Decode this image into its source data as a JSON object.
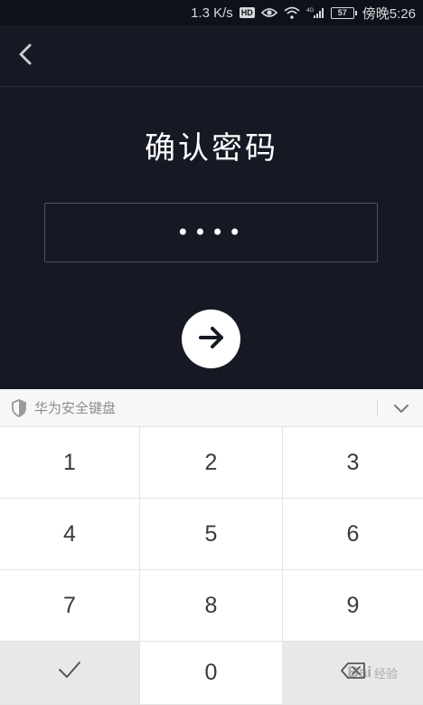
{
  "status_bar": {
    "network_speed": "1.3 K/s",
    "hd_badge": "HD",
    "battery": "57",
    "time": "傍晚5:26",
    "icons": [
      "eye-icon",
      "wifi-icon",
      "4g-signal-icon",
      "battery-icon"
    ]
  },
  "header": {
    "back_icon": "chevron-left-icon"
  },
  "page": {
    "title": "确认密码",
    "password_value": "••••",
    "next_icon": "arrow-right-icon"
  },
  "keyboard": {
    "name": "华为安全键盘",
    "shield_icon": "shield-icon",
    "collapse_icon": "chevron-down-icon",
    "keys": [
      "1",
      "2",
      "3",
      "4",
      "5",
      "6",
      "7",
      "8",
      "9",
      "0"
    ],
    "confirm_icon": "checkmark-icon",
    "delete_icon": "backspace-icon"
  },
  "watermark": {
    "text": "Bai",
    "sub": "经验"
  },
  "colors": {
    "background": "#161924",
    "keyboard_bg": "#f5f5f5",
    "key_bg": "#ffffff",
    "func_key_bg": "#e8e8e8"
  }
}
